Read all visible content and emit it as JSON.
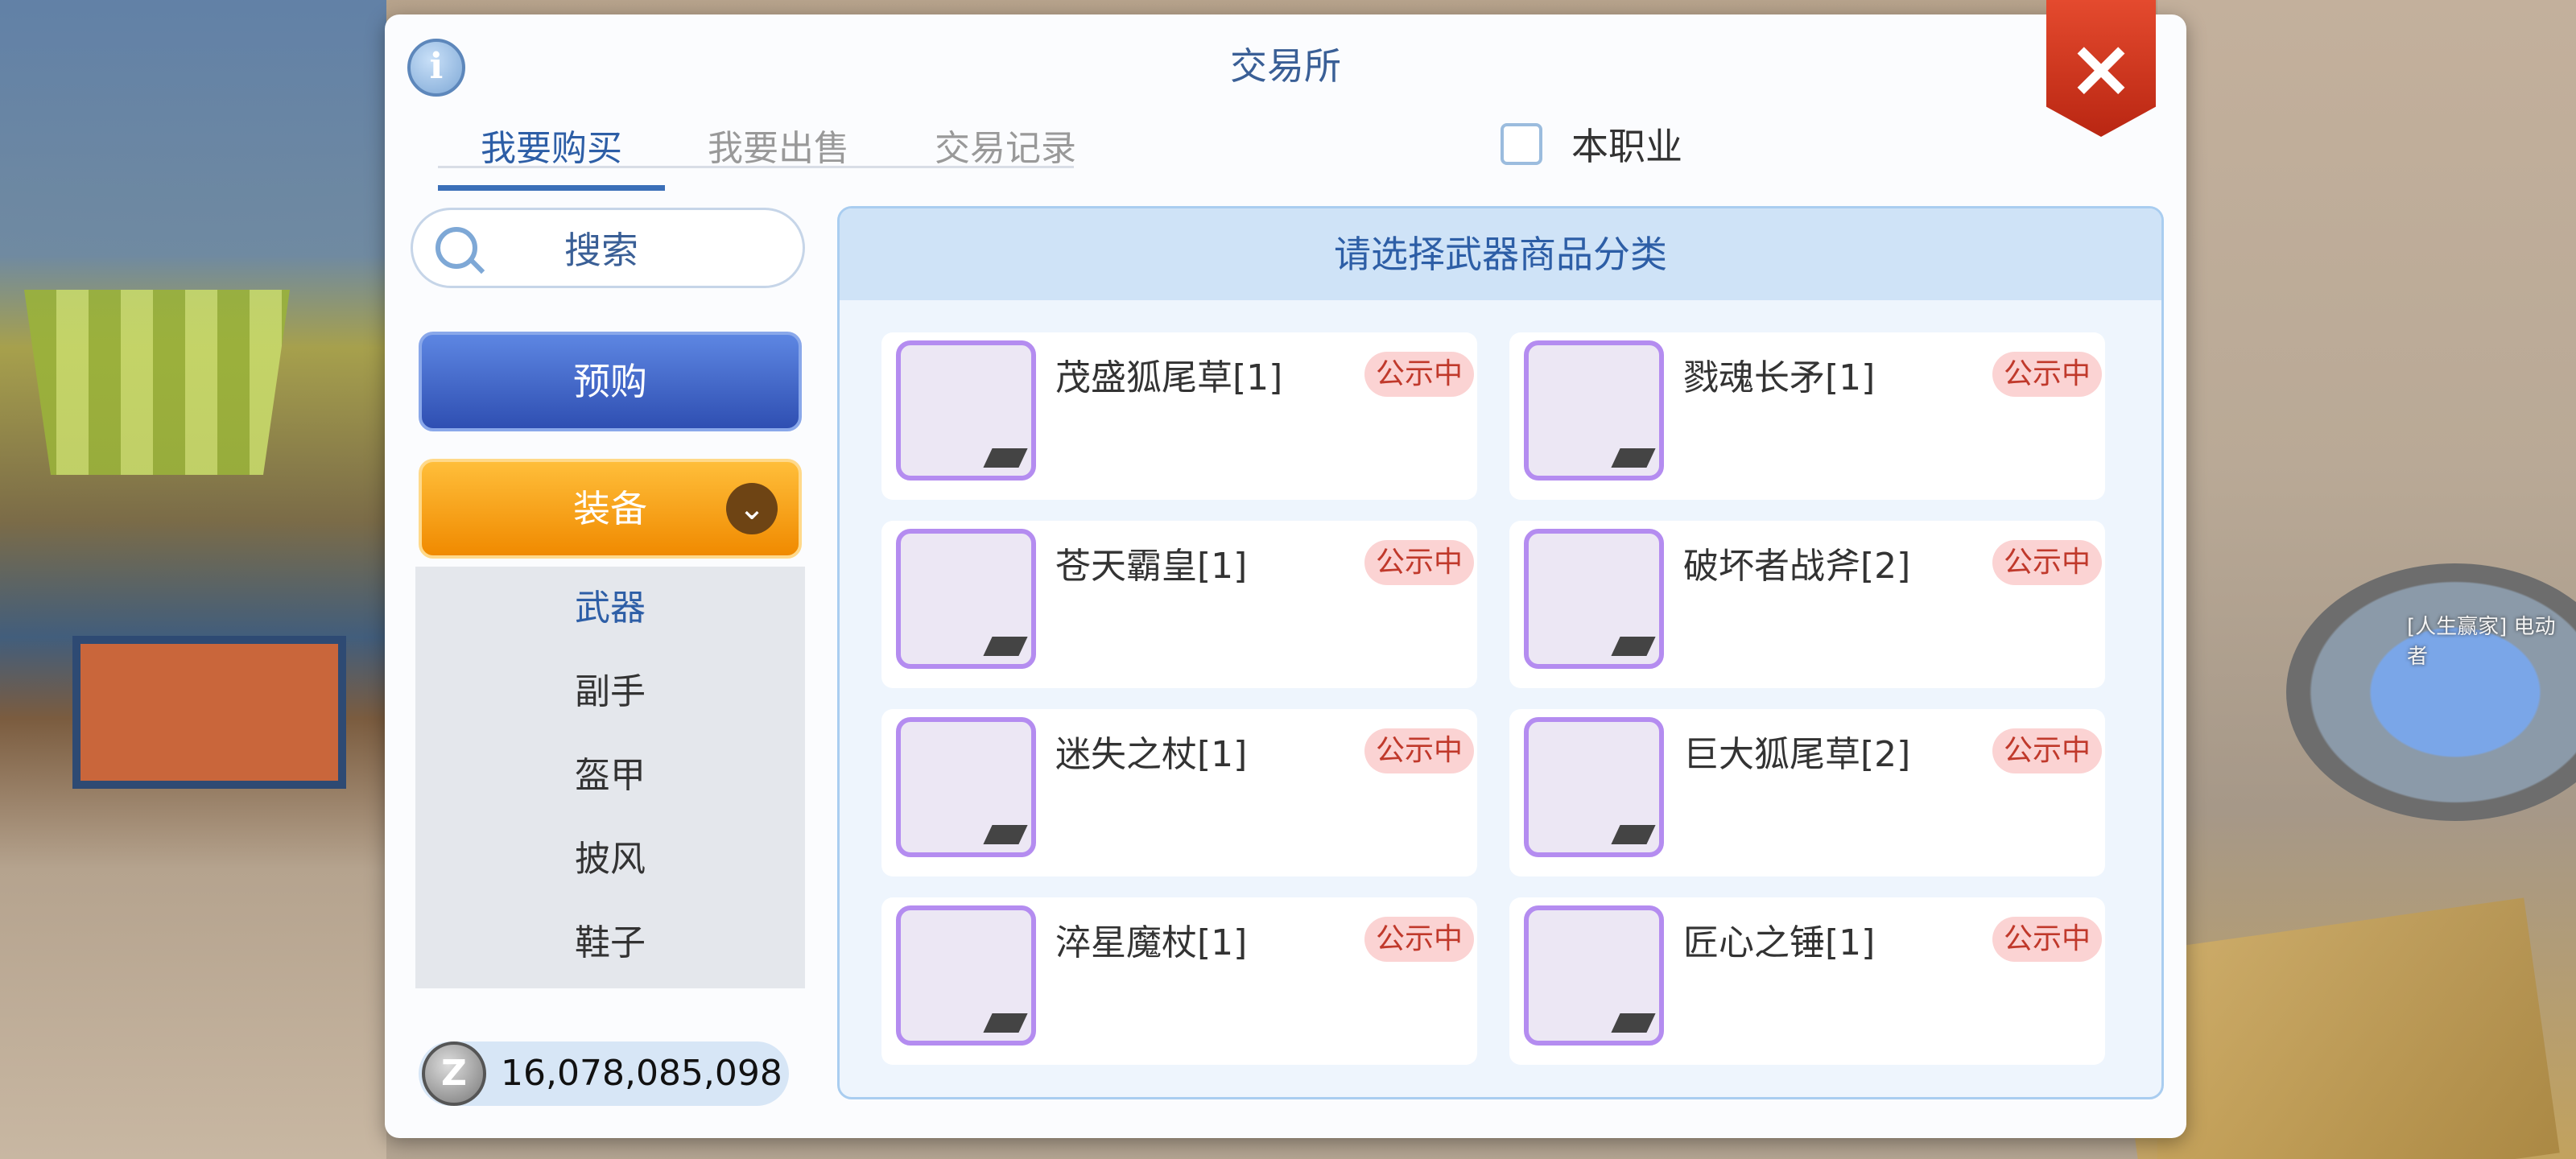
{
  "scene": {
    "npc_label": "[人生赢家] 电动者"
  },
  "dialog": {
    "title": "交易所",
    "info_label": "i",
    "close_label": "×",
    "tabs": [
      {
        "label": "我要购买",
        "active": true
      },
      {
        "label": "我要出售",
        "active": false
      },
      {
        "label": "交易记录",
        "active": false
      }
    ],
    "job_filter_label": "本职业",
    "search_label": "搜索",
    "preorder_label": "预购",
    "equipment_label": "装备",
    "categories": [
      "武器",
      "副手",
      "盔甲",
      "披风",
      "鞋子"
    ],
    "zeny_value": "16,078,085,098",
    "zeny_coin_label": "Z",
    "panel_header": "请选择武器商品分类",
    "items": [
      {
        "name": "茂盛狐尾草[1]",
        "status": "公示中",
        "icon": "fox-tail-grass-icon"
      },
      {
        "name": "戮魂长矛[1]",
        "status": "公示中",
        "icon": "soul-spear-icon"
      },
      {
        "name": "苍天霸皇[1]",
        "status": "公示中",
        "icon": "sky-emperor-weapon-icon"
      },
      {
        "name": "破坏者战斧[2]",
        "status": "公示中",
        "icon": "destroyer-axe-icon"
      },
      {
        "name": "迷失之杖[1]",
        "status": "公示中",
        "icon": "lost-staff-icon"
      },
      {
        "name": "巨大狐尾草[2]",
        "status": "公示中",
        "icon": "giant-fox-tail-icon"
      },
      {
        "name": "淬星魔杖[1]",
        "status": "公示中",
        "icon": "star-wand-icon"
      },
      {
        "name": "匠心之锤[1]",
        "status": "公示中",
        "icon": "craftsman-hammer-icon"
      }
    ]
  },
  "colors": {
    "accent": "#2d5ea6",
    "equip": "#f5a012",
    "preorder": "#3f61c4",
    "badge": "#c0392b",
    "item_border": "#b48cf0"
  }
}
